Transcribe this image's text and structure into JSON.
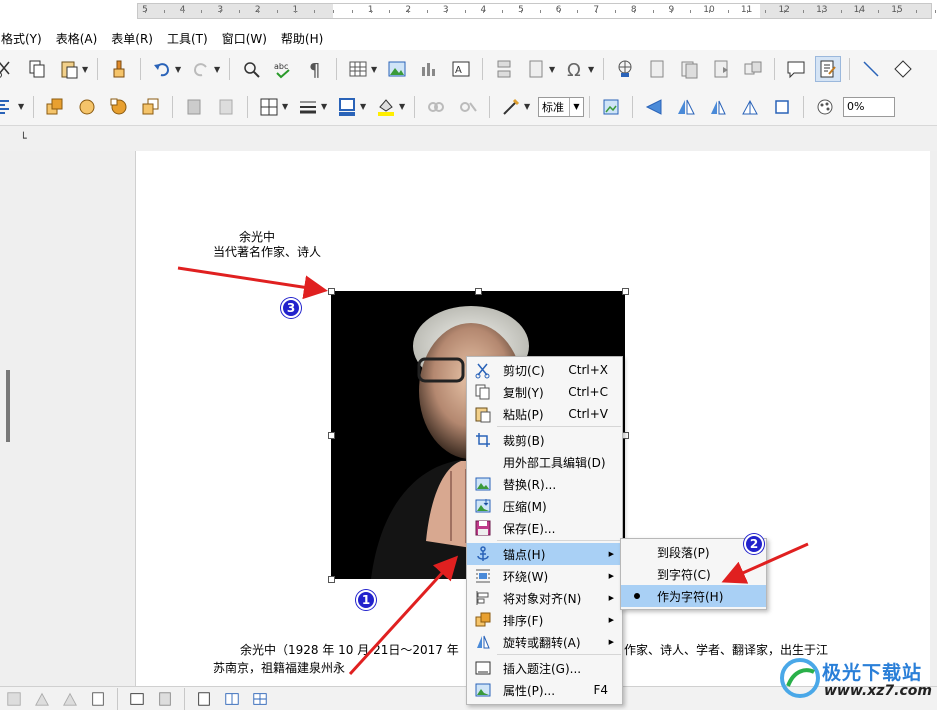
{
  "menubar": {
    "items": [
      "格式(Y)",
      "表格(A)",
      "表单(R)",
      "工具(T)",
      "窗口(W)",
      "帮助(H)"
    ]
  },
  "toolbar2": {
    "style_combo": "标准",
    "transparency": "0%"
  },
  "ruler": {
    "labels": [
      "5",
      "4",
      "3",
      "2",
      "1",
      "1",
      "2",
      "3",
      "4",
      "5",
      "6",
      "7",
      "8",
      "9",
      "10",
      "11",
      "12",
      "13",
      "14",
      "15"
    ]
  },
  "document": {
    "author_name": "余光中",
    "author_subtitle": "当代著名作家、诗人",
    "bio_line1": "余光中（1928 年 10 月 21日～2017 年",
    "bio_line1_tail": "作家、诗人、学者、翻译家，出生于江",
    "bio_line2": "苏南京，祖籍福建泉州永"
  },
  "context_menu": {
    "items": [
      {
        "label": "剪切(C)",
        "shortcut": "Ctrl+X",
        "icon": "scissors-icon"
      },
      {
        "label": "复制(Y)",
        "shortcut": "Ctrl+C",
        "icon": "copy-icon"
      },
      {
        "label": "粘贴(P)",
        "shortcut": "Ctrl+V",
        "icon": "paste-icon"
      },
      {
        "label": "裁剪(B)",
        "shortcut": "",
        "icon": "crop-icon"
      },
      {
        "label": "用外部工具编辑(D)",
        "shortcut": "",
        "icon": ""
      },
      {
        "label": "替换(R)...",
        "shortcut": "",
        "icon": "replace-image-icon"
      },
      {
        "label": "压缩(M)",
        "shortcut": "",
        "icon": "compress-image-icon"
      },
      {
        "label": "保存(E)...",
        "shortcut": "",
        "icon": "save-icon"
      },
      {
        "label": "锚点(H)",
        "shortcut": "",
        "icon": "anchor-icon",
        "submenu": true
      },
      {
        "label": "环绕(W)",
        "shortcut": "",
        "icon": "wrap-icon",
        "submenu": true
      },
      {
        "label": "将对象对齐(N)",
        "shortcut": "",
        "icon": "align-objects-icon",
        "submenu": true
      },
      {
        "label": "排序(F)",
        "shortcut": "",
        "icon": "arrange-icon",
        "submenu": true
      },
      {
        "label": "旋转或翻转(A)",
        "shortcut": "",
        "icon": "rotate-flip-icon",
        "submenu": true
      },
      {
        "label": "插入题注(G)...",
        "shortcut": "",
        "icon": "caption-icon"
      },
      {
        "label": "属性(P)...",
        "shortcut": "F4",
        "icon": "properties-icon"
      }
    ],
    "highlighted": "锚点(H)"
  },
  "anchor_submenu": {
    "items": [
      {
        "label": "到段落(P)"
      },
      {
        "label": "到字符(C)"
      },
      {
        "label": "作为字符(H)",
        "selected": true
      }
    ]
  },
  "annotations": {
    "badges": [
      "1",
      "2",
      "3"
    ],
    "arrow_color": "#e02020",
    "badge_color": "#2222cc"
  },
  "watermark": {
    "name": "极光下载站",
    "url": "www.xz7.com"
  },
  "colors": {
    "menu_highlight": "#a9d0f5",
    "page_bg": "#ffffff",
    "workspace_bg": "#efefef"
  }
}
